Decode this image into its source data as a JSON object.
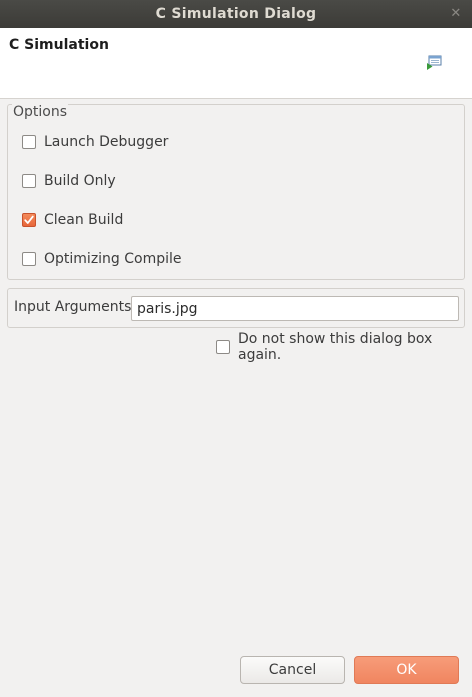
{
  "window": {
    "title": "C Simulation Dialog",
    "close_glyph": "✕"
  },
  "header": {
    "title": "C Simulation",
    "icon": "run-simulation-icon"
  },
  "options": {
    "legend": "Options",
    "items": [
      {
        "label": "Launch Debugger",
        "checked": false
      },
      {
        "label": "Build Only",
        "checked": false
      },
      {
        "label": "Clean Build",
        "checked": true
      },
      {
        "label": "Optimizing Compile",
        "checked": false
      }
    ]
  },
  "input_arguments": {
    "label": "Input Arguments",
    "value": "paris.jpg"
  },
  "dont_show": {
    "label": "Do not show this dialog box again.",
    "checked": false
  },
  "buttons": {
    "cancel_label": "Cancel",
    "ok_label": "OK"
  },
  "colors": {
    "titlebar": "#3c3b37",
    "accent": "#f08560",
    "background": "#f2f1f0"
  }
}
